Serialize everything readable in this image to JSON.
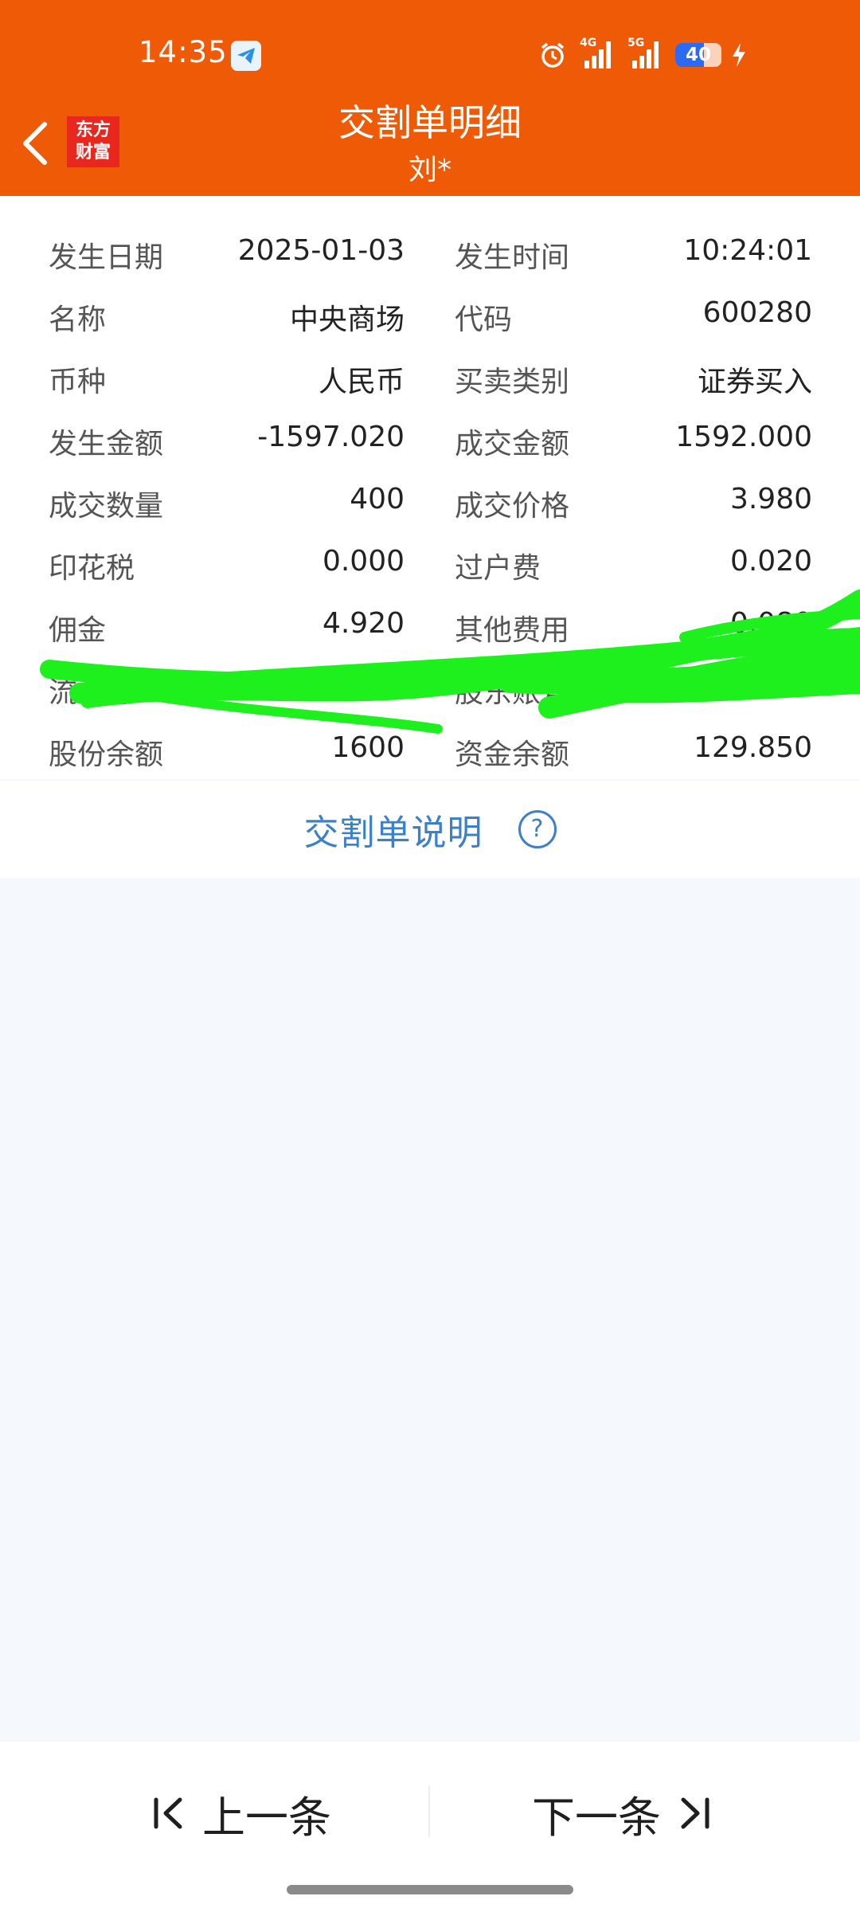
{
  "status_bar": {
    "time": "14:35",
    "network_1": "4G",
    "network_2": "5G",
    "battery": "40"
  },
  "header": {
    "title": "交割单明细",
    "subtitle": "刘*",
    "logo_line1": "东方",
    "logo_line2": "财富"
  },
  "detail_rows": [
    {
      "label_left": "发生日期",
      "value_left": "2025-01-03",
      "label_right": "发生时间",
      "value_right": "10:24:01"
    },
    {
      "label_left": "名称",
      "value_left": "中央商场",
      "label_right": "代码",
      "value_right": "600280"
    },
    {
      "label_left": "币种",
      "value_left": "人民币",
      "label_right": "买卖类别",
      "value_right": "证券买入"
    },
    {
      "label_left": "发生金额",
      "value_left": "-1597.020",
      "label_right": "成交金额",
      "value_right": "1592.000"
    },
    {
      "label_left": "成交数量",
      "value_left": "400",
      "label_right": "成交价格",
      "value_right": "3.980"
    },
    {
      "label_left": "印花税",
      "value_left": "0.000",
      "label_right": "过户费",
      "value_right": "0.020"
    },
    {
      "label_left": "佣金",
      "value_left": "4.920",
      "label_right": "其他费用",
      "value_right": "0.080"
    },
    {
      "label_left": "流水号",
      "value_left": "",
      "label_right": "股东账号",
      "value_right": ""
    },
    {
      "label_left": "股份余额",
      "value_left": "1600",
      "label_right": "资金余额",
      "value_right": "129.850"
    }
  ],
  "explain": {
    "label": "交割单说明",
    "icon": "?"
  },
  "footer": {
    "prev_label": "上一条",
    "next_label": "下一条"
  },
  "colors": {
    "header_bg": "#ef5a06",
    "link_blue": "#3b80c9",
    "redaction_green": "#1ef01e"
  }
}
